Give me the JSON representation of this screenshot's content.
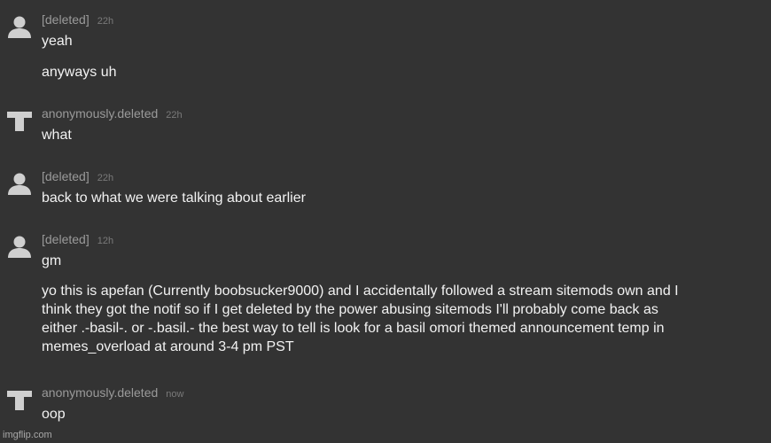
{
  "messages": [
    {
      "user": "[deleted]",
      "time": "22h",
      "avatar": "person-icon",
      "lines": [
        "yeah",
        "anyways uh"
      ]
    },
    {
      "user": "anonymously.deleted",
      "time": "22h",
      "avatar": "tee-icon",
      "lines": [
        "what"
      ]
    },
    {
      "user": "[deleted]",
      "time": "22h",
      "avatar": "person-icon",
      "lines": [
        "back to what we were talking about earlier"
      ]
    },
    {
      "user": "[deleted]",
      "time": "12h",
      "avatar": "person-icon",
      "lines": [
        "gm",
        "yo this is apefan (Currently boobsucker9000) and I accidentally followed a stream sitemods own and I\nthink they got the notif so if I get deleted by the power abusing sitemods I'll probably come back as\neither .-basil-. or -.basil.- the best way to tell is look for a basil omori themed announcement temp in\nmemes_overload at around 3-4 pm PST"
      ]
    },
    {
      "user": "anonymously.deleted",
      "time": "now",
      "avatar": "tee-icon",
      "lines": [
        "oop"
      ]
    }
  ],
  "watermark": "imgflip.com",
  "colors": {
    "background": "#333333",
    "text": "#f2f2f2",
    "username": "#9a9a9a",
    "timestamp": "#7a7a7a",
    "avatar": "#cfcfcf"
  }
}
